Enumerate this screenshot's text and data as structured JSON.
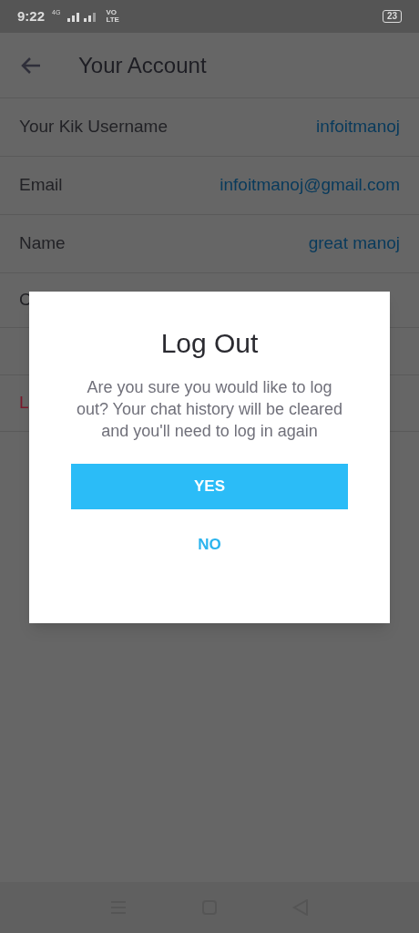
{
  "status_bar": {
    "time": "9:22",
    "network": "4G",
    "volte": "VO LTE",
    "battery": "23"
  },
  "header": {
    "title": "Your Account"
  },
  "rows": [
    {
      "kind": "field",
      "label": "Your Kik Username",
      "value": "infoitmanoj"
    },
    {
      "kind": "field",
      "label": "Email",
      "value": "infoitmanoj@gmail.com"
    },
    {
      "kind": "field",
      "label": "Name",
      "value": "great manoj"
    },
    {
      "kind": "plain",
      "label": "C"
    },
    {
      "kind": "blank"
    },
    {
      "kind": "danger",
      "label": "L"
    }
  ],
  "dialog": {
    "title": "Log Out",
    "message": "Are you sure you would like to log out? Your chat history will be cleared and you'll need to log in again",
    "buttons": [
      {
        "kind": "primary",
        "label": "YES"
      },
      {
        "kind": "text",
        "label": "NO"
      }
    ]
  }
}
